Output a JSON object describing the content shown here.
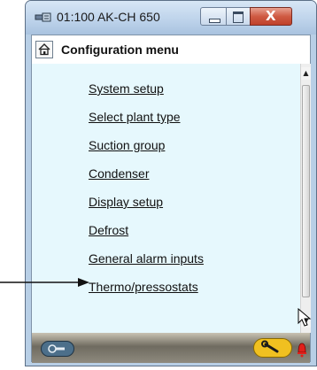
{
  "window": {
    "title": "01:100 AK-CH 650",
    "controls": {
      "close_label": "X"
    }
  },
  "header": {
    "title": "Configuration menu"
  },
  "menu": {
    "items": [
      {
        "label": "System setup"
      },
      {
        "label": "Select plant type"
      },
      {
        "label": "Suction group"
      },
      {
        "label": "Condenser"
      },
      {
        "label": "Display setup"
      },
      {
        "label": "Defrost"
      },
      {
        "label": "General alarm inputs"
      },
      {
        "label": "Thermo/pressostats"
      }
    ]
  },
  "footer": {
    "left_icon": "service-tool-icon",
    "right_icon": "wrench-icon",
    "alarm_icon": "alarm-bell-icon"
  },
  "colors": {
    "content_bg": "#e6f8fd",
    "titlebar": "#bcd2ea",
    "close_button": "#c0412a"
  }
}
